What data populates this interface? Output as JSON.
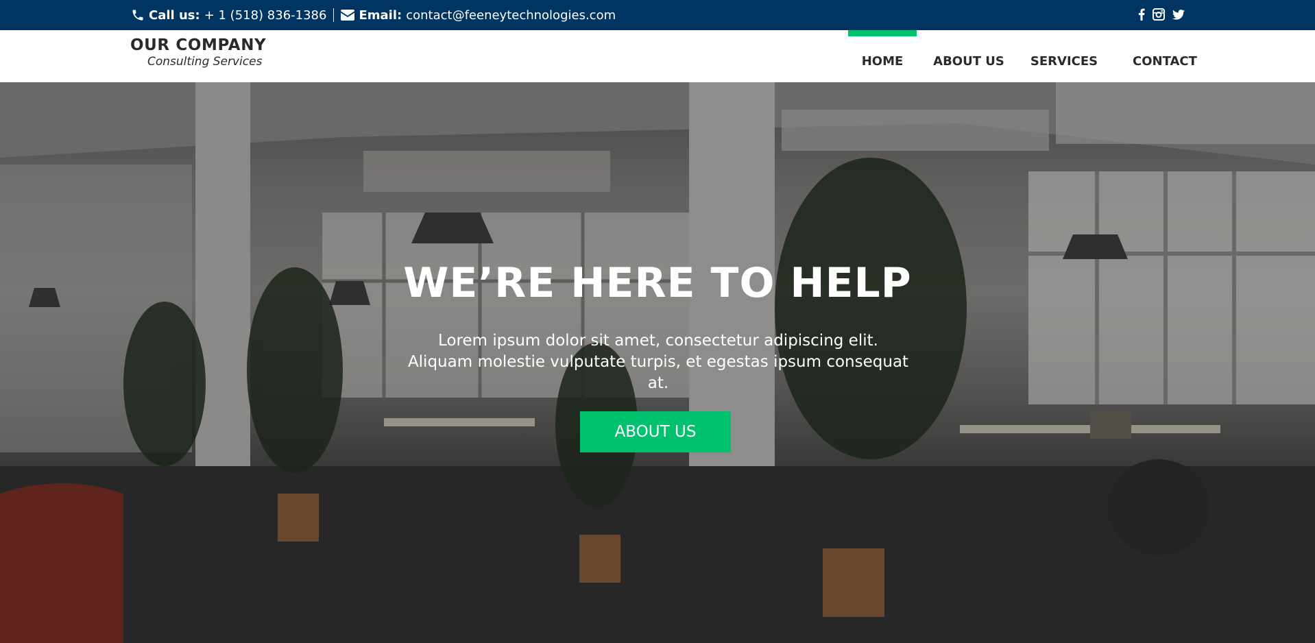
{
  "topbar": {
    "phone_label": "Call us:",
    "phone_value": "+ 1 (518) 836-1386",
    "email_label": "Email:",
    "email_value": "contact@feeneytechnologies.com",
    "social": [
      "facebook-icon",
      "instagram-icon",
      "twitter-icon"
    ]
  },
  "brand": {
    "name": "OUR COMPANY",
    "tagline": "Consulting Services"
  },
  "nav": {
    "items": [
      {
        "label": "HOME",
        "active": true
      },
      {
        "label": "ABOUT US",
        "active": false
      },
      {
        "label": "SERVICES",
        "active": false
      },
      {
        "label": "CONTACT",
        "active": false
      }
    ]
  },
  "hero": {
    "title": "WE’RE HERE TO HELP",
    "text": "Lorem ipsum dolor sit amet, consectetur adipiscing elit. Aliquam molestie vulputate turpis, et egestas ipsum consequat at.",
    "button_label": "ABOUT US"
  },
  "colors": {
    "topbar_bg": "#003562",
    "accent": "#00c16e",
    "header_bg": "#ffffff",
    "nav_text": "#2a2a2a"
  }
}
